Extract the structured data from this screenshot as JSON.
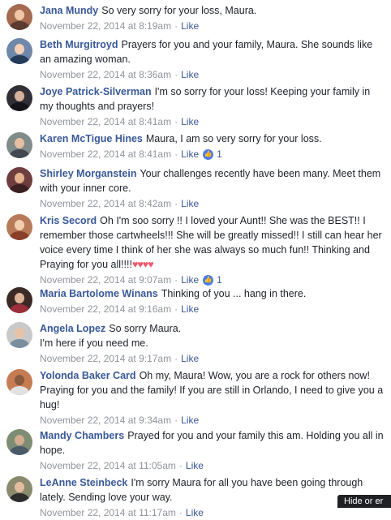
{
  "comments": [
    {
      "author": "Jana Mundy",
      "text": "So very sorry for your loss, Maura.",
      "date": "November 22, 2014 at 8:19am",
      "like": "Like",
      "reactions": ""
    },
    {
      "author": "Beth Murgitroyd",
      "text": "Prayers for you and your family, Maura. She sounds like an amazing woman.",
      "date": "November 22, 2014 at 8:36am",
      "like": "Like",
      "reactions": ""
    },
    {
      "author": "Joye Patrick-Silverman",
      "text": "I'm so sorry for your loss! Keeping your family in my thoughts and prayers!",
      "date": "November 22, 2014 at 8:41am",
      "like": "Like",
      "reactions": ""
    },
    {
      "author": "Karen McTigue Hines",
      "text": "Maura, I am so very sorry for your loss.",
      "date": "November 22, 2014 at 8:41am",
      "like": "Like",
      "reactions": "1"
    },
    {
      "author": "Shirley Morganstein",
      "text": "Your challenges recently have been many. Meet them with your inner core.",
      "date": "November 22, 2014 at 8:42am",
      "like": "Like",
      "reactions": ""
    },
    {
      "author": "Kris Secord",
      "text": "Oh I'm soo sorry !! I loved your Aunt!! She was the BEST!! I remember those cartwheels!!! She will be greatly missed!! I still can hear her voice every time I think of her she was always so much fun!! Thinking and Praying for you all!!!!",
      "emoji": "♥♥♥♥",
      "date": "November 22, 2014 at 9:07am",
      "like": "Like",
      "reactions": "1"
    },
    {
      "author": "Maria Bartolome Winans",
      "text": "Thinking of you ... hang in there.",
      "date": "November 22, 2014 at 9:16am",
      "like": "Like",
      "reactions": ""
    },
    {
      "author": "Angela Lopez",
      "text": "So sorry Maura.",
      "text2": "I'm here if you need me.",
      "date": "November 22, 2014 at 9:17am",
      "like": "Like",
      "reactions": ""
    },
    {
      "author": "Yolonda Baker Card",
      "text": "Oh my, Maura! Wow, you are a rock for others now! Praying for you and the family! If you are still in Orlando, I need to give you a hug!",
      "date": "November 22, 2014 at 9:34am",
      "like": "Like",
      "reactions": ""
    },
    {
      "author": "Mandy Chambers",
      "text": "Prayed for you and your family this am. Holding you all in hope.",
      "date": "November 22, 2014 at 11:05am",
      "like": "Like",
      "reactions": ""
    },
    {
      "author": "LeAnne Steinbeck",
      "text": "I'm sorry Maura for all you have been going through lately. Sending love your way.",
      "date": "November 22, 2014 at 11:17am",
      "like": "Like",
      "reactions": ""
    }
  ],
  "hide_button": "Hide or er",
  "colors": {
    "link": "#385898",
    "meta": "#90949c",
    "text": "#1d2129",
    "reaction": "#4c7cf0",
    "heart": "#f0586c"
  },
  "icons": {
    "reaction": "thumbs-up-icon",
    "emoji": "heart-icon"
  }
}
